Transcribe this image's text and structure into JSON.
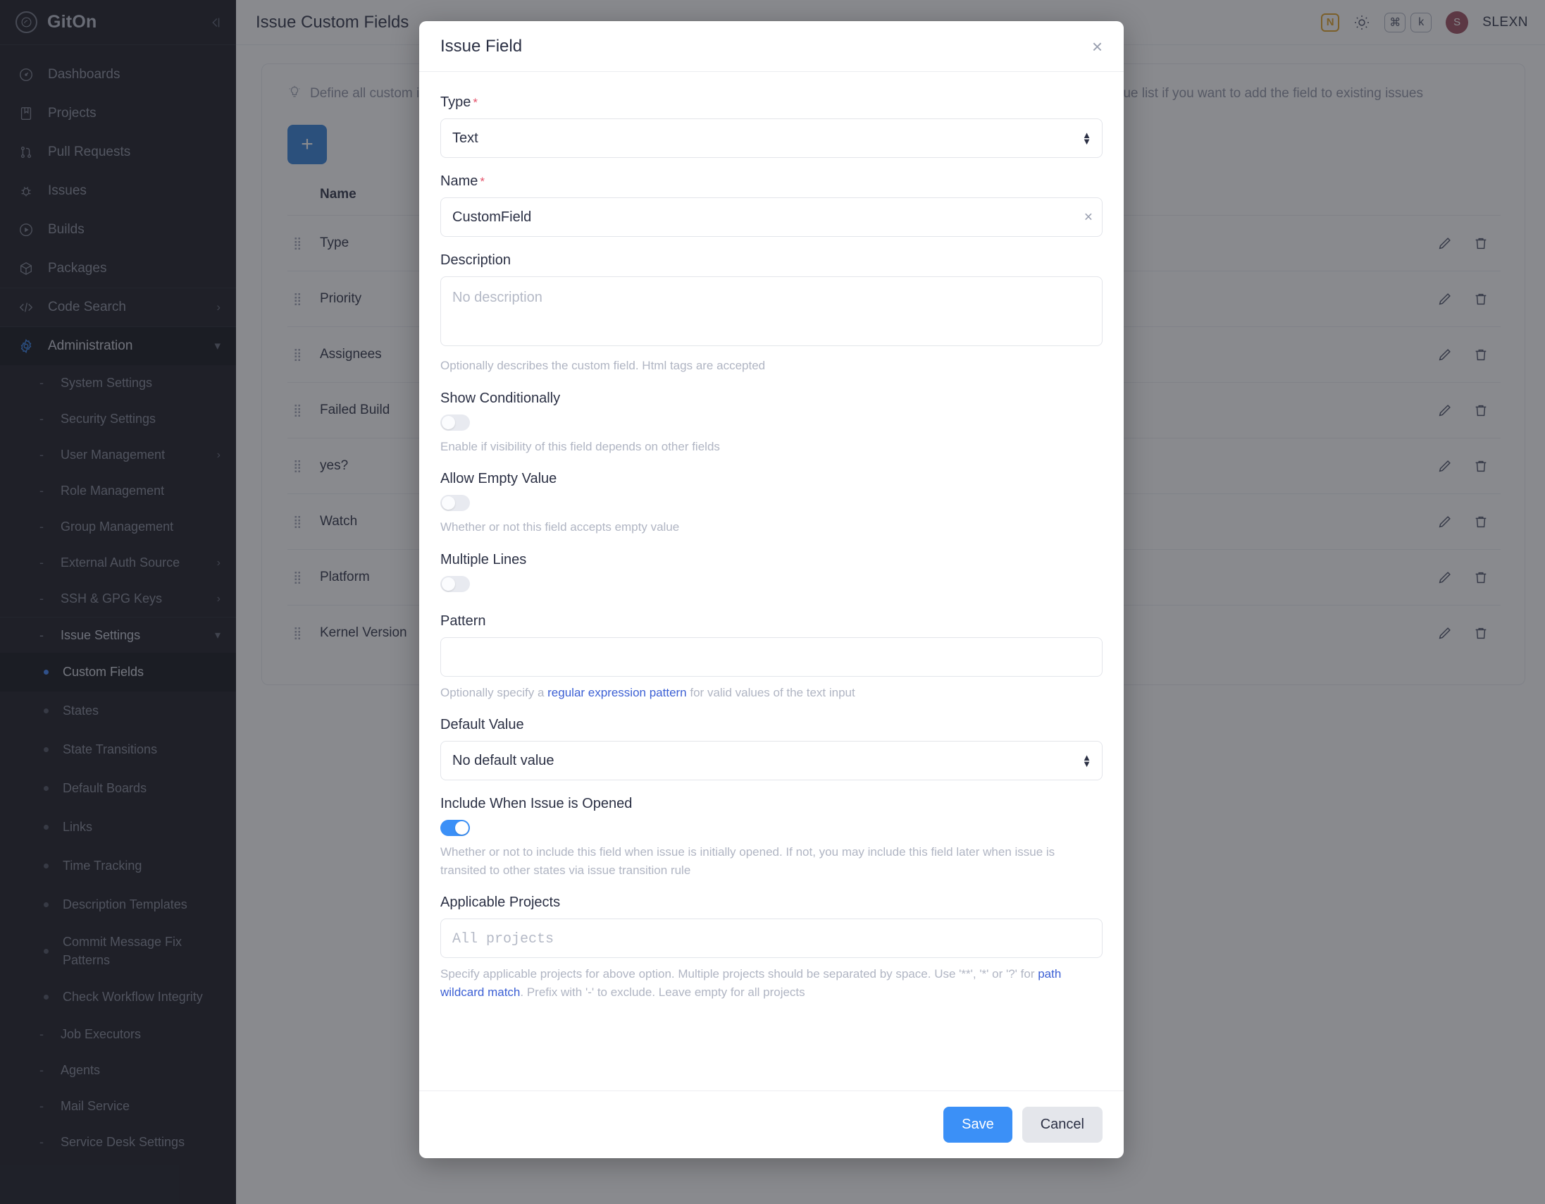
{
  "sidebar": {
    "brand": "GitOn",
    "collapse_icon": "collapse-sidebar-icon",
    "nav": [
      {
        "label": "Dashboards",
        "icon": "gauge-icon"
      },
      {
        "label": "Projects",
        "icon": "book-icon"
      },
      {
        "label": "Pull Requests",
        "icon": "pull-request-icon"
      },
      {
        "label": "Issues",
        "icon": "bug-icon"
      },
      {
        "label": "Builds",
        "icon": "play-circle-icon"
      },
      {
        "label": "Packages",
        "icon": "package-icon"
      },
      {
        "label": "Code Search",
        "icon": "code-icon",
        "chevron": "›"
      },
      {
        "label": "Administration",
        "icon": "gear-icon",
        "chevron": "ⱟ",
        "active": true
      }
    ],
    "admin_items": [
      {
        "label": "System Settings"
      },
      {
        "label": "Security Settings"
      },
      {
        "label": "User Management",
        "chevron": "›"
      },
      {
        "label": "Role Management"
      },
      {
        "label": "Group Management"
      },
      {
        "label": "External Auth Source",
        "chevron": "›"
      },
      {
        "label": "SSH & GPG Keys",
        "chevron": "›"
      },
      {
        "label": "Issue Settings",
        "chevron": "ⱟ",
        "expanded": true
      }
    ],
    "issue_settings_items": [
      {
        "label": "Custom Fields",
        "current": true
      },
      {
        "label": "States"
      },
      {
        "label": "State Transitions"
      },
      {
        "label": "Default Boards"
      },
      {
        "label": "Links"
      },
      {
        "label": "Time Tracking"
      },
      {
        "label": "Description Templates"
      },
      {
        "label": "Commit Message Fix Patterns"
      },
      {
        "label": "Check Workflow Integrity"
      }
    ],
    "admin_items_tail": [
      {
        "label": "Job Executors"
      },
      {
        "label": "Agents"
      },
      {
        "label": "Mail Service"
      },
      {
        "label": "Service Desk Settings"
      }
    ]
  },
  "topbar": {
    "title": "Issue Custom Fields",
    "badge": "N",
    "theme_icon": "sun-icon",
    "shortcut_keys": [
      "⌘",
      "k"
    ],
    "avatar_initial": "S",
    "user_name": "SLEXN"
  },
  "main": {
    "hint": "Define all custom issue fields here. Note that newly defined fields by default only appear in new issues. Batch edit existing issues from issue list if you want to add the field to existing issues",
    "add_button_label": "+",
    "table": {
      "headers": [
        "Name"
      ],
      "rows": [
        {
          "name": "Type"
        },
        {
          "name": "Priority"
        },
        {
          "name": "Assignees"
        },
        {
          "name": "Failed Build"
        },
        {
          "name": "yes?"
        },
        {
          "name": "Watch"
        },
        {
          "name": "Platform"
        },
        {
          "name": "Kernel Version"
        }
      ],
      "row_actions": [
        {
          "icon": "pencil-icon",
          "name": "edit"
        },
        {
          "icon": "trash-icon",
          "name": "delete"
        }
      ]
    }
  },
  "modal": {
    "title": "Issue Field",
    "close_label": "×",
    "fields": {
      "type": {
        "label": "Type",
        "required": "*",
        "value": "Text"
      },
      "name": {
        "label": "Name",
        "required": "*",
        "value": "CustomField",
        "clear_label": "×"
      },
      "description": {
        "label": "Description",
        "value": "",
        "placeholder": "No description",
        "helper": "Optionally describes the custom field. Html tags are accepted"
      },
      "show_conditionally": {
        "label": "Show Conditionally",
        "state": "off",
        "helper": "Enable if visibility of this field depends on other fields"
      },
      "allow_empty_value": {
        "label": "Allow Empty Value",
        "state": "off",
        "helper": "Whether or not this field accepts empty value"
      },
      "multiple_lines": {
        "label": "Multiple Lines",
        "state": "off"
      },
      "pattern": {
        "label": "Pattern",
        "value": "",
        "helper_pre": "Optionally specify a ",
        "helper_link": "regular expression pattern",
        "helper_post": " for valid values of the text input"
      },
      "default_value": {
        "label": "Default Value",
        "value": "No default value"
      },
      "include_when_opened": {
        "label": "Include When Issue is Opened",
        "state": "on",
        "helper": "Whether or not to include this field when issue is initially opened. If not, you may include this field later when issue is transited to other states via issue transition rule"
      },
      "applicable_projects": {
        "label": "Applicable Projects",
        "value": "",
        "placeholder": "All projects",
        "helper_pre": "Specify applicable projects for above option. Multiple projects should be separated by space. Use '**', '*' or '?' for ",
        "helper_link": "path wildcard match",
        "helper_post": ". Prefix with '-' to exclude. Leave empty for all projects"
      }
    },
    "footer": {
      "save_label": "Save",
      "cancel_label": "Cancel"
    }
  },
  "colors": {
    "accent": "#3b90f7",
    "sidebar_bg": "#14161d",
    "required": "#e4526a",
    "link": "#3b5fd4",
    "badge": "#e0a020"
  }
}
